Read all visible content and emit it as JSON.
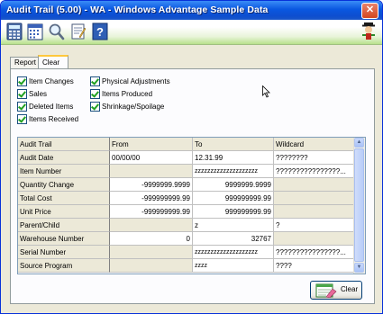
{
  "window": {
    "title": "Audit Trail (5.00) - WA - Windows Advantage Sample Data",
    "close_glyph": "✕"
  },
  "toolbar": {
    "icons": [
      "calculator-icon",
      "calendar-icon",
      "magnifier-icon",
      "notes-icon",
      "help-icon"
    ],
    "help_glyph": "?"
  },
  "tabs": [
    {
      "label": "Report",
      "active": false
    },
    {
      "label": "Clear",
      "active": true
    }
  ],
  "checkboxes": {
    "left": [
      {
        "label": "Item Changes",
        "checked": true
      },
      {
        "label": "Sales",
        "checked": true
      },
      {
        "label": "Deleted Items",
        "checked": true
      },
      {
        "label": "Items Received",
        "checked": true
      }
    ],
    "right": [
      {
        "label": "Physical Adjustments",
        "checked": true
      },
      {
        "label": "Items Produced",
        "checked": true
      },
      {
        "label": "Shrinkage/Spoilage",
        "checked": true
      }
    ]
  },
  "grid": {
    "headers": [
      "Audit Trail",
      "From",
      "To",
      "Wildcard"
    ],
    "rows": [
      [
        "Audit Date",
        "00/00/00",
        "12.31.99",
        "????????"
      ],
      [
        "Item Number",
        "",
        "zzzzzzzzzzzzzzzzzzzz",
        "????????????????..."
      ],
      [
        "Quantity Change",
        "-9999999.9999",
        "9999999.9999",
        ""
      ],
      [
        "Total Cost",
        "-999999999.99",
        "999999999.99",
        ""
      ],
      [
        "Unit Price",
        "-999999999.99",
        "999999999.99",
        ""
      ],
      [
        "Parent/Child",
        "",
        "z",
        "?"
      ],
      [
        "Warehouse Number",
        "0",
        "32767",
        ""
      ],
      [
        "Serial Number",
        "",
        "zzzzzzzzzzzzzzzzzzzz",
        "????????????????..."
      ],
      [
        "Source Program",
        "",
        "zzzz",
        "????"
      ]
    ]
  },
  "scrollbar": {
    "up_glyph": "▲",
    "down_glyph": "▼"
  },
  "buttons": {
    "clear": "Clear"
  }
}
